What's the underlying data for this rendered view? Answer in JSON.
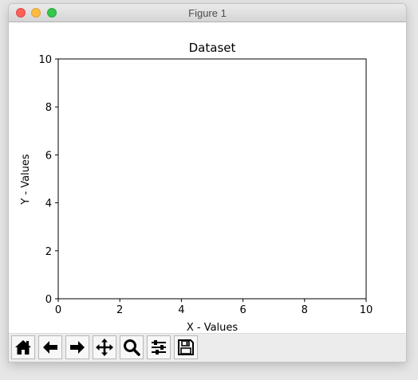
{
  "window": {
    "title": "Figure 1"
  },
  "chart_data": {
    "type": "scatter",
    "title": "Dataset",
    "xlabel": "X - Values",
    "ylabel": "Y - Values",
    "xlim": [
      0,
      10
    ],
    "ylim": [
      0,
      10
    ],
    "xticks": [
      "0",
      "2",
      "4",
      "6",
      "8",
      "10"
    ],
    "yticks": [
      "0",
      "2",
      "4",
      "6",
      "8",
      "10"
    ],
    "series": [],
    "grid": false
  },
  "toolbar": {
    "buttons": [
      {
        "name": "home",
        "icon": "home-icon"
      },
      {
        "name": "back",
        "icon": "arrow-left-icon"
      },
      {
        "name": "forward",
        "icon": "arrow-right-icon"
      },
      {
        "name": "pan",
        "icon": "move-icon"
      },
      {
        "name": "zoom",
        "icon": "magnifier-icon"
      },
      {
        "name": "configure-subplots",
        "icon": "sliders-icon"
      },
      {
        "name": "save",
        "icon": "floppy-disk-icon"
      }
    ]
  }
}
